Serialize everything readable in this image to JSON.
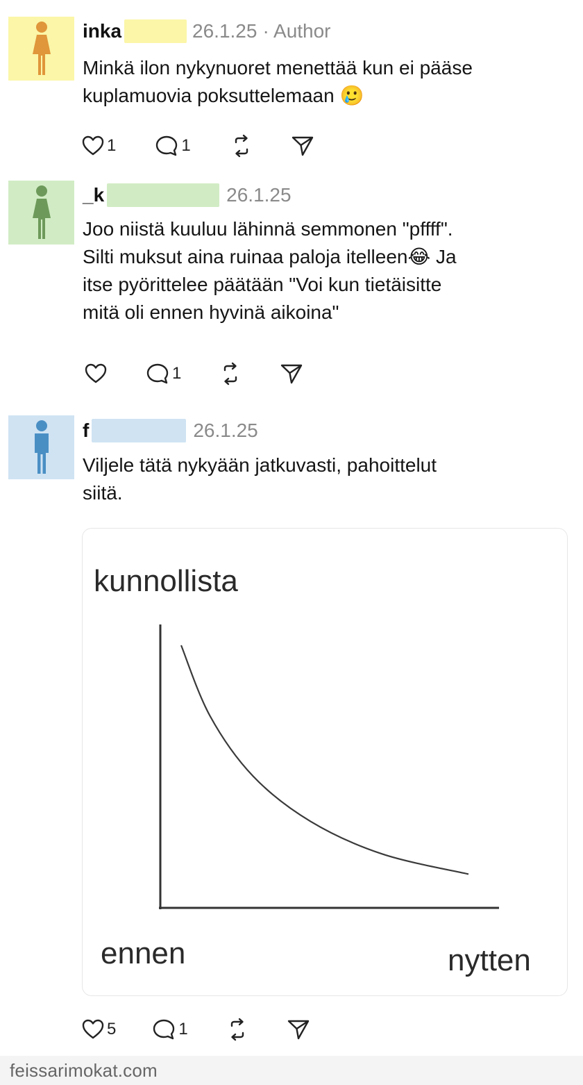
{
  "posts": [
    {
      "username": "inka",
      "redact_color": "#fbf6a8",
      "date": "26.1.25",
      "author_tag": "· Author",
      "avatar_bg": "#fbf6a8",
      "avatar_icon": "woman-icon",
      "avatar_color": "#e0963a",
      "text_lines": [
        "Minkä ilon nykynuoret menettää kun ei pääse",
        "kuplamuovia poksuttelemaan 🥲"
      ],
      "likes": "1",
      "replies": "1"
    },
    {
      "username": "_k",
      "redact_color": "#d1ecc4",
      "date": "26.1.25",
      "avatar_bg": "#d1ecc4",
      "avatar_icon": "woman-icon",
      "avatar_color": "#6d9a5a",
      "text_lines": [
        "Joo niistä kuuluu lähinnä semmonen \"pffff\".",
        "Silti muksut aina ruinaa paloja itelleen😂 Ja",
        "itse pyörittelee päätään \"Voi kun tietäisitte",
        "mitä oli ennen hyvinä aikoina\""
      ],
      "likes": "",
      "replies": "1"
    },
    {
      "username": "f",
      "redact_color": "#cfe3f3",
      "date": "26.1.25",
      "avatar_bg": "#cfe3f3",
      "avatar_icon": "man-icon",
      "avatar_color": "#4a8fc4",
      "text_lines": [
        "Viljele tätä nykyään jatkuvasti, pahoittelut",
        "siitä."
      ],
      "likes": "5",
      "replies": "1"
    }
  ],
  "chart_data": {
    "type": "line",
    "title": "kunnollista",
    "xlabel_left": "ennen",
    "xlabel_right": "nytten",
    "description_values": [
      {
        "x": 0.0,
        "y": 1.0
      },
      {
        "x": 0.1,
        "y": 0.72
      },
      {
        "x": 0.25,
        "y": 0.48
      },
      {
        "x": 0.45,
        "y": 0.3
      },
      {
        "x": 0.7,
        "y": 0.17
      },
      {
        "x": 1.0,
        "y": 0.09
      }
    ],
    "grid": false
  },
  "watermark": "feissarimokat.com"
}
